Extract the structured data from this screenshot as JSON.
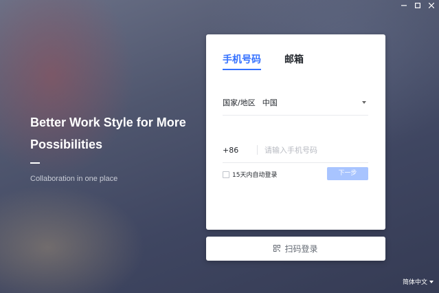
{
  "window": {
    "minimize_icon": "minimize-icon",
    "maximize_icon": "maximize-icon",
    "close_icon": "close-icon"
  },
  "hero": {
    "title": "Better Work Style for More Possibilities",
    "subtitle": "Collaboration in one place"
  },
  "login": {
    "tabs": [
      {
        "label": "手机号码",
        "active": true
      },
      {
        "label": "邮箱",
        "active": false
      }
    ],
    "country_label": "国家/地区",
    "country_value": "中国",
    "dial_code": "+86",
    "phone_placeholder": "请输入手机号码",
    "phone_value": "",
    "remember_label": "15天内自动登录",
    "remember_checked": false,
    "next_label": "下一步"
  },
  "qr_login": {
    "label": "扫码登录",
    "icon": "qr-code-icon"
  },
  "language": {
    "label": "简体中文"
  },
  "colors": {
    "accent": "#3370ff",
    "next_button": "#a8c4ff"
  }
}
